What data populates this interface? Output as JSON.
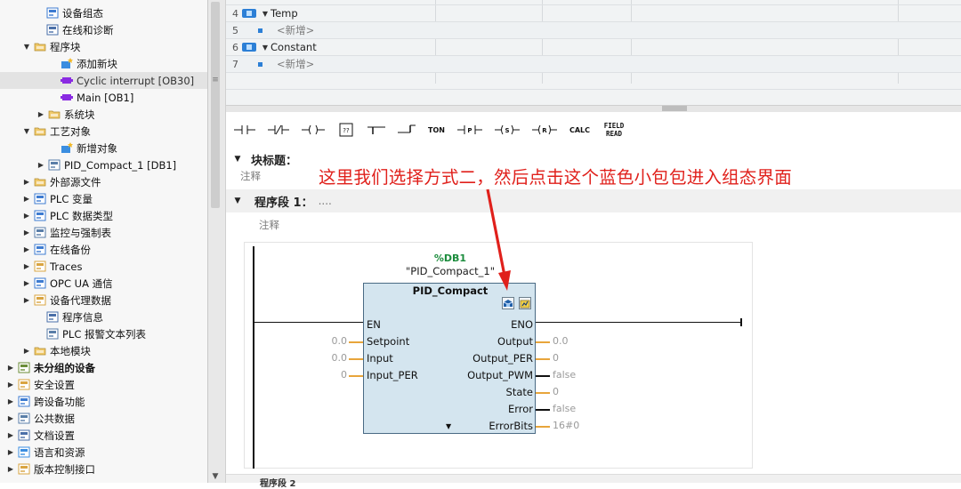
{
  "tree": {
    "items": [
      {
        "label": "设备组态",
        "icon": "device-config-icon",
        "arrow": "none",
        "indent": 52
      },
      {
        "label": "在线和诊断",
        "icon": "online-diag-icon",
        "arrow": "none",
        "indent": 52
      },
      {
        "label": "程序块",
        "icon": "folder-icon",
        "arrow": "expanded",
        "indent": 38
      },
      {
        "label": "添加新块",
        "icon": "add-block-icon",
        "arrow": "none",
        "indent": 68
      },
      {
        "label": "Cyclic interrupt [OB30]",
        "icon": "ob-block-icon",
        "arrow": "none",
        "indent": 68,
        "selected": true
      },
      {
        "label": "Main [OB1]",
        "icon": "ob-block-icon",
        "arrow": "none",
        "indent": 68
      },
      {
        "label": "系统块",
        "icon": "folder-icon",
        "arrow": "collapsed",
        "indent": 54
      },
      {
        "label": "工艺对象",
        "icon": "folder-icon",
        "arrow": "expanded",
        "indent": 38
      },
      {
        "label": "新增对象",
        "icon": "add-block-icon",
        "arrow": "none",
        "indent": 68
      },
      {
        "label": "PID_Compact_1 [DB1]",
        "icon": "pid-object-icon",
        "arrow": "collapsed",
        "indent": 54
      },
      {
        "label": "外部源文件",
        "icon": "folder-icon",
        "arrow": "collapsed",
        "indent": 38
      },
      {
        "label": "PLC 变量",
        "icon": "plc-tags-icon",
        "arrow": "collapsed",
        "indent": 38
      },
      {
        "label": "PLC 数据类型",
        "icon": "plc-datatype-icon",
        "arrow": "collapsed",
        "indent": 38
      },
      {
        "label": "监控与强制表",
        "icon": "watch-table-icon",
        "arrow": "collapsed",
        "indent": 38
      },
      {
        "label": "在线备份",
        "icon": "online-backup-icon",
        "arrow": "collapsed",
        "indent": 38
      },
      {
        "label": "Traces",
        "icon": "traces-icon",
        "arrow": "collapsed",
        "indent": 38
      },
      {
        "label": "OPC UA 通信",
        "icon": "opcua-icon",
        "arrow": "collapsed",
        "indent": 38
      },
      {
        "label": "设备代理数据",
        "icon": "proxy-data-icon",
        "arrow": "collapsed",
        "indent": 38
      },
      {
        "label": "程序信息",
        "icon": "program-info-icon",
        "arrow": "none",
        "indent": 52
      },
      {
        "label": "PLC 报警文本列表",
        "icon": "alarm-text-icon",
        "arrow": "none",
        "indent": 52
      },
      {
        "label": "本地模块",
        "icon": "folder-icon",
        "arrow": "collapsed",
        "indent": 38
      },
      {
        "label": "未分组的设备",
        "icon": "ungrouped-devices-icon",
        "arrow": "collapsed",
        "indent": 20,
        "bold": true
      },
      {
        "label": "安全设置",
        "icon": "security-icon",
        "arrow": "collapsed",
        "indent": 20
      },
      {
        "label": "跨设备功能",
        "icon": "cross-device-icon",
        "arrow": "collapsed",
        "indent": 20
      },
      {
        "label": "公共数据",
        "icon": "common-data-icon",
        "arrow": "collapsed",
        "indent": 20
      },
      {
        "label": "文档设置",
        "icon": "doc-settings-icon",
        "arrow": "collapsed",
        "indent": 20
      },
      {
        "label": "语言和资源",
        "icon": "language-icon",
        "arrow": "collapsed",
        "indent": 20
      },
      {
        "label": "版本控制接口",
        "icon": "version-control-icon",
        "arrow": "collapsed",
        "indent": 20
      }
    ]
  },
  "interface": {
    "rows": [
      {
        "num": "4",
        "kind": "section",
        "name": "Temp"
      },
      {
        "num": "5",
        "kind": "add",
        "name": "<新增>"
      },
      {
        "num": "6",
        "kind": "section",
        "name": "Constant"
      },
      {
        "num": "7",
        "kind": "add",
        "name": "<新增>"
      }
    ]
  },
  "toolbar": {
    "buttons": [
      {
        "id": "no-contact",
        "label": ""
      },
      {
        "id": "nc-contact",
        "label": ""
      },
      {
        "id": "coil",
        "label": ""
      },
      {
        "id": "empty-box",
        "label": "??"
      },
      {
        "id": "open-branch",
        "label": ""
      },
      {
        "id": "close-branch",
        "label": ""
      },
      {
        "id": "ton",
        "label": "TON"
      },
      {
        "id": "p-edge",
        "label": "P"
      },
      {
        "id": "set-coil",
        "label": "S"
      },
      {
        "id": "reset-coil",
        "label": "R"
      },
      {
        "id": "calc",
        "label": "CALC"
      },
      {
        "id": "field-read",
        "label": "FIELD READ"
      }
    ]
  },
  "editor": {
    "block_title_label": "块标题：",
    "block_comment": "注释",
    "segment_label": "程序段 1：",
    "segment_dots": "....",
    "segment_comment": "注释",
    "bottom_segment_label": "程序段 2"
  },
  "fb": {
    "db_address": "%DB1",
    "instance": "\"PID_Compact_1\"",
    "title": "PID_Compact",
    "inputs": [
      {
        "name": "EN",
        "value": ""
      },
      {
        "name": "Setpoint",
        "value": "0.0"
      },
      {
        "name": "Input",
        "value": "0.0"
      },
      {
        "name": "Input_PER",
        "value": "0"
      }
    ],
    "outputs": [
      {
        "name": "ENO",
        "value": ""
      },
      {
        "name": "Output",
        "value": "0.0"
      },
      {
        "name": "Output_PER",
        "value": "0"
      },
      {
        "name": "Output_PWM",
        "value": "false"
      },
      {
        "name": "State",
        "value": "0"
      },
      {
        "name": "Error",
        "value": "false"
      },
      {
        "name": "ErrorBits",
        "value": "16#0"
      }
    ]
  },
  "annotation": {
    "text": "这里我们选择方式二，然后点击这个蓝色小包包进入组态界面",
    "color": "#e0201b"
  },
  "colors": {
    "fb_fill": "#d4e5ef",
    "wire_orange": "#e8a53b",
    "address_green": "#1b8c3c"
  }
}
